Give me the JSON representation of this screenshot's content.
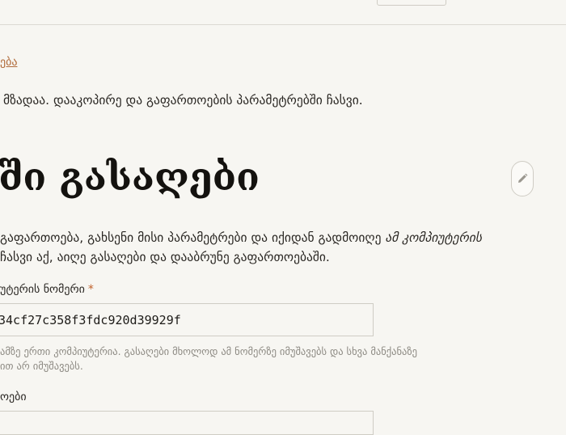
{
  "breadcrumb": {
    "link_text": "ება"
  },
  "status": {
    "ready_message": "მზადაა. დააკოპირე და გაფართოების პარამეტრებში ჩასვი."
  },
  "page": {
    "title": "ში გასაღები"
  },
  "edit": {
    "icon": "pencil-icon"
  },
  "intro": {
    "line1_start": "გაფართოება, გახსენი მისი პარამეტრები და იქიდან გადმოიღე ",
    "line1_emphasis": "ამ კომპიუტერის",
    "line2": "ჩასვი აქ, აიღე გასაღები და დააბრუნე გაფართოებაში."
  },
  "computer_number_field": {
    "label": "უტერის ნომერი",
    "required_mark": "*",
    "value": "34cf27c358f3fdc920d39929f",
    "hint_line1": "ამზე ერთი კომპიუტერია. გასაღები მხოლოდ ამ ნომერზე იმუშავებს და სხვა მანქანაზე",
    "hint_line2": "ით არ იმუშავებს."
  },
  "second_field": {
    "label": "ოები"
  }
}
